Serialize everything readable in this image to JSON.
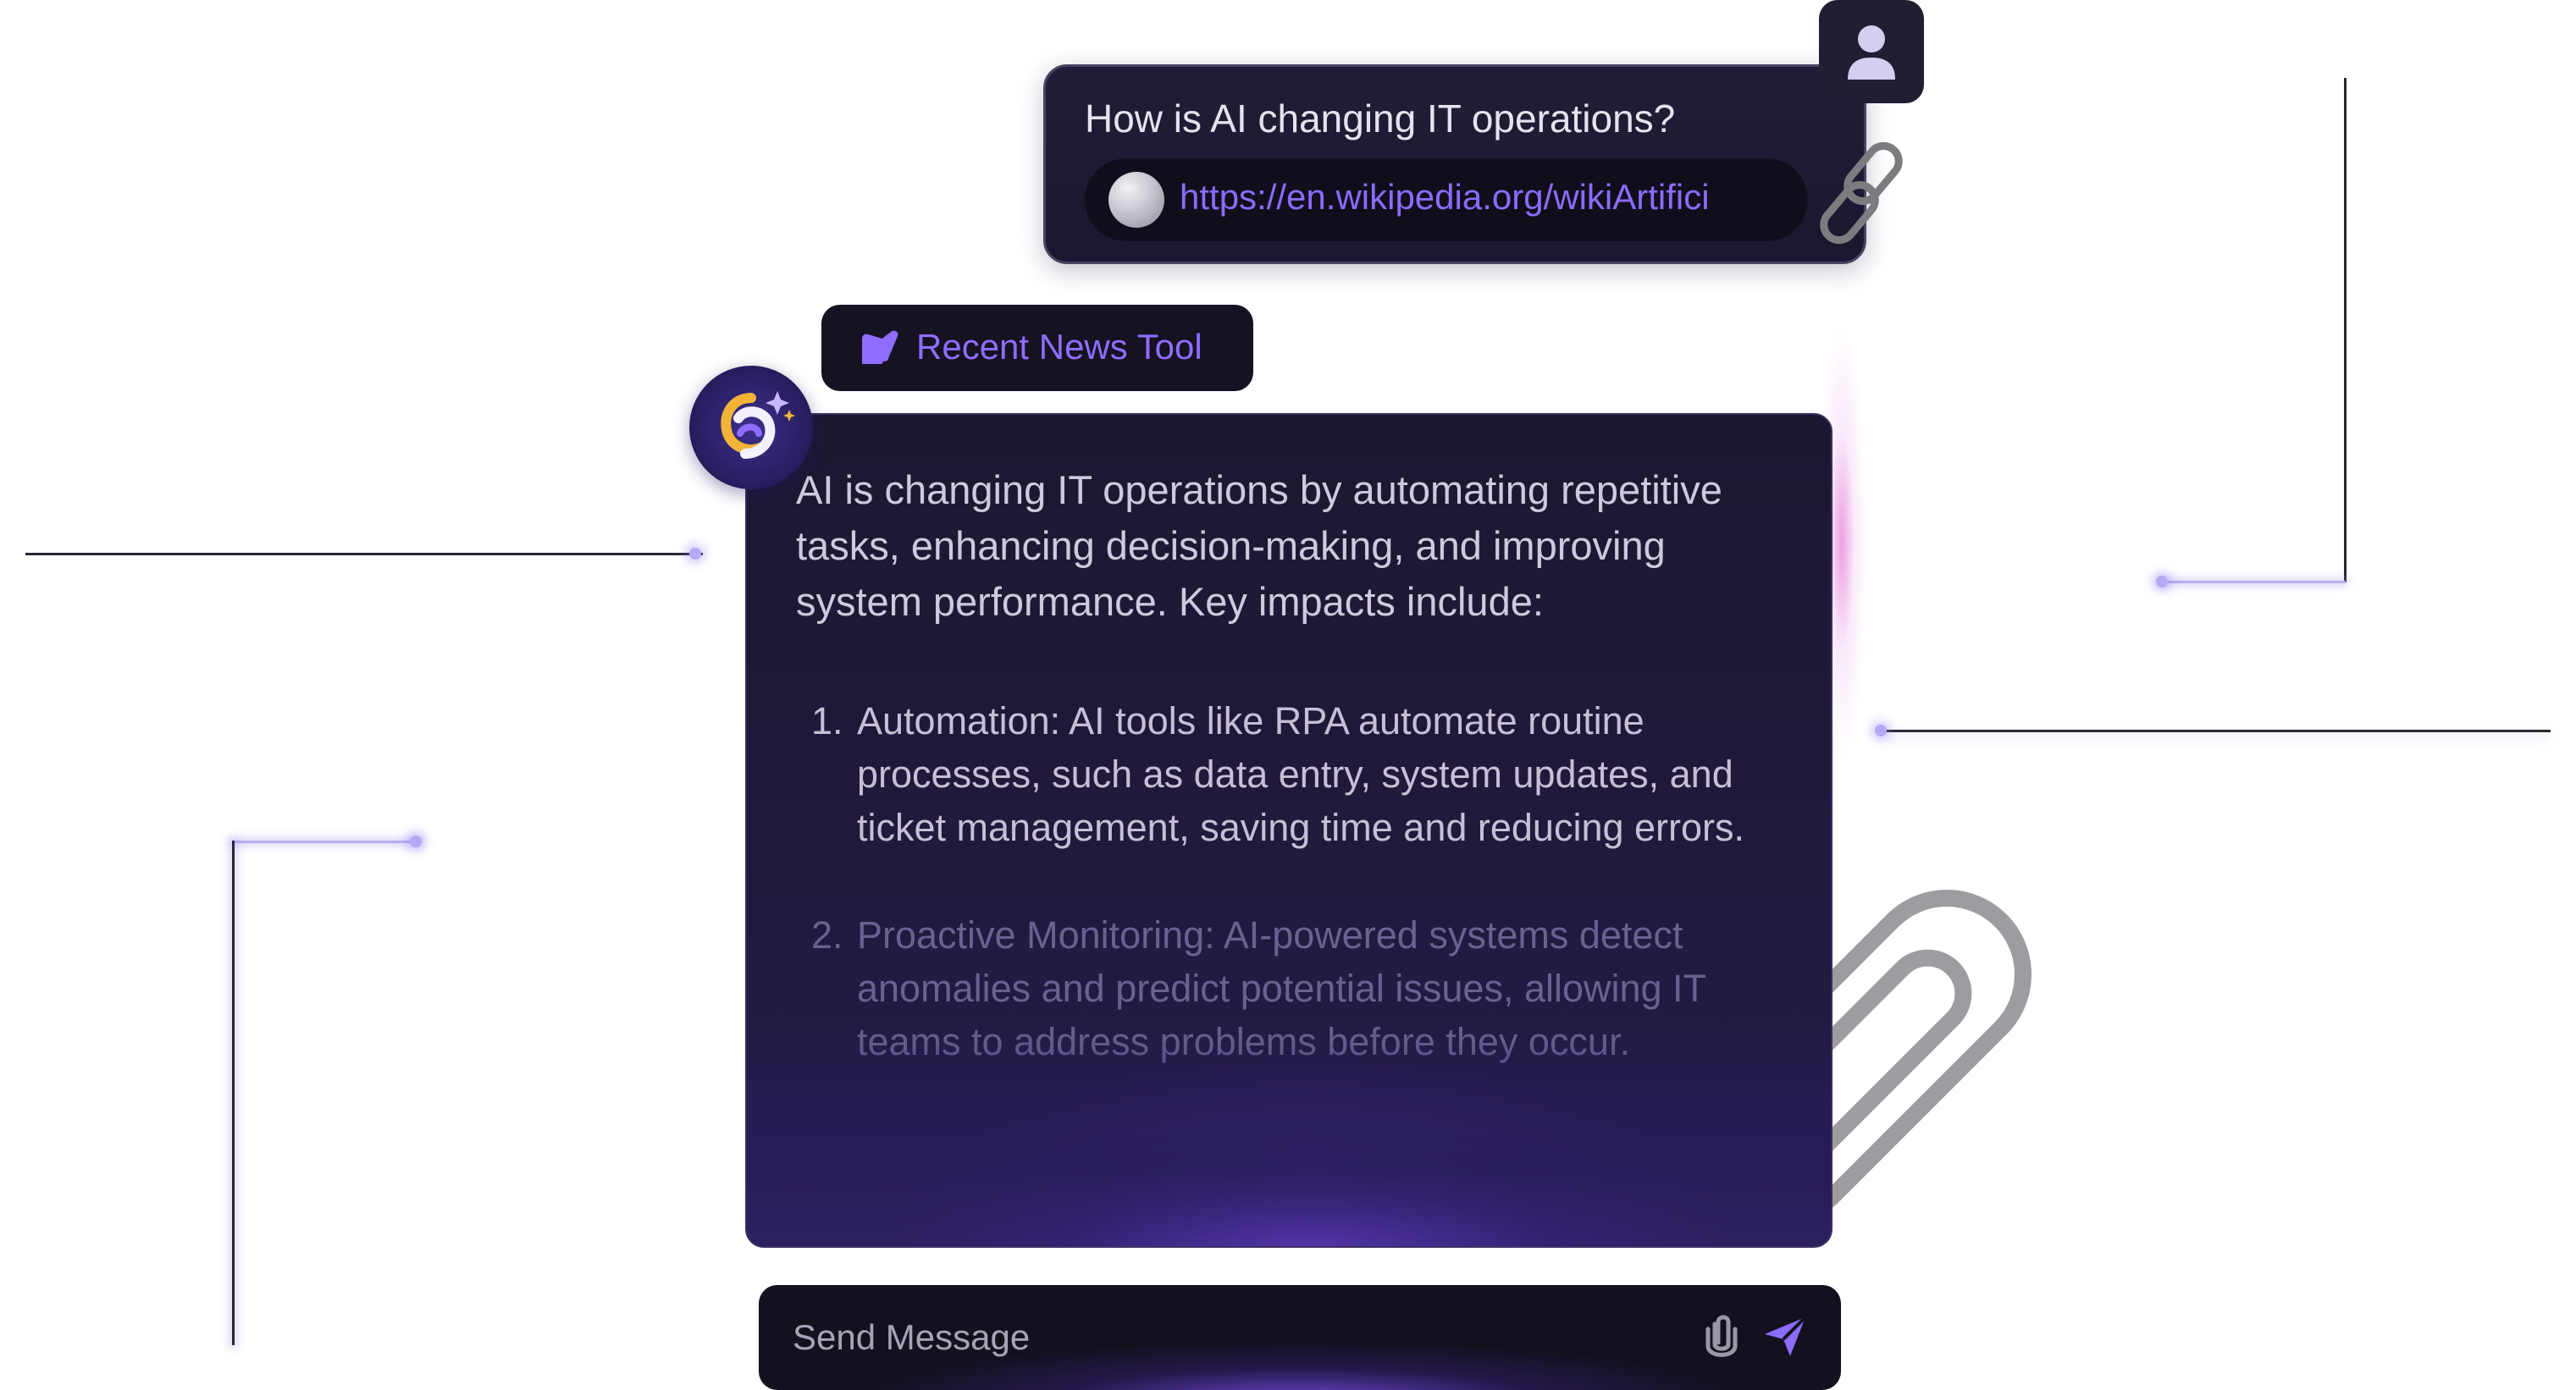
{
  "user_message": {
    "question": "How is AI changing IT operations?",
    "link_url": "https://en.wikipedia.org/wikiArtifici",
    "link_icon": "wikipedia-globe-icon"
  },
  "tool": {
    "label": "Recent News Tool",
    "icon": "news-tool-icon"
  },
  "assistant": {
    "intro": "AI is changing IT operations by automating repetitive tasks, enhancing decision-making, and improving system performance. Key impacts include:",
    "items": [
      {
        "num": "1.",
        "text": "Automation: AI tools like RPA automate routine processes, such as data entry, system updates, and ticket management, saving time and reducing errors."
      },
      {
        "num": "2.",
        "text": "Proactive Monitoring: AI-powered systems detect anomalies and predict potential issues, allowing IT teams to address problems before they occur."
      }
    ]
  },
  "composer": {
    "placeholder": "Send Message"
  },
  "colors": {
    "accent": "#8a6cff",
    "bubble_bg": "#1c1730",
    "page_bg": "#ffffff"
  }
}
